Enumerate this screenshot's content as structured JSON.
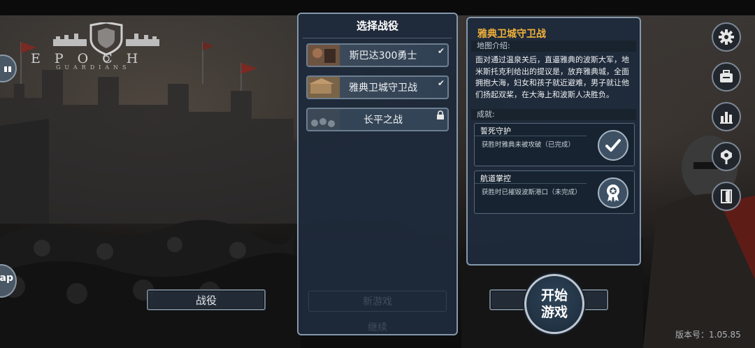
{
  "logo": {
    "title": "EPOCH",
    "subtitle": "GUARDIANS"
  },
  "left_edge": {
    "bottom_label": "ap"
  },
  "campaign_button": {
    "label": "战役"
  },
  "campaign_select": {
    "title": "选择战役",
    "items": [
      {
        "label": "斯巴达300勇士",
        "status": "completed"
      },
      {
        "label": "雅典卫城守卫战",
        "status": "completed"
      },
      {
        "label": "长平之战",
        "status": "locked"
      }
    ],
    "faded_buttons": [
      "新游戏",
      "继续"
    ]
  },
  "campaign_info": {
    "title": "雅典卫城守卫战",
    "intro_label": "地图介绍:",
    "intro_text": "面对通过温泉关后，直逼雅典的波斯大军，地米斯托克利给出的提议是，放弃雅典城，全面拥抱大海，妇女和孩子就近避难，男子就让他们扬起双桨，在大海上和波斯人决胜负。",
    "achievements_label": "成就:",
    "achievements": [
      {
        "name": "誓死守护",
        "desc": "获胜时雅典未被攻破（已完成）",
        "icon": "check-icon"
      },
      {
        "name": "航道掌控",
        "desc": "获胜时已摧毁波斯港口（未完成）",
        "icon": "medal-icon"
      }
    ]
  },
  "side_menu": [
    "gear-icon",
    "briefcase-icon",
    "bar-chart-icon",
    "key-icon",
    "exit-door-icon"
  ],
  "start_button": {
    "line1": "开始",
    "line2": "游戏"
  },
  "version": "版本号：1.05.85",
  "colors": {
    "accent_gold": "#f2b23a",
    "panel_bg": "#1e2a3a",
    "panel_border": "#8598ab"
  }
}
